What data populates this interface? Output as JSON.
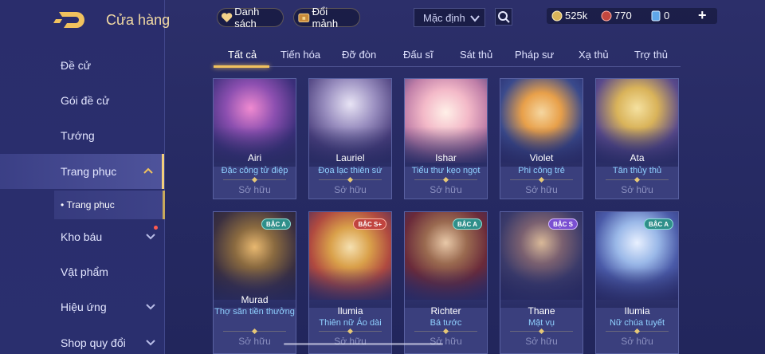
{
  "header": {
    "title": "Cửa hàng"
  },
  "sidebar": {
    "items": [
      {
        "label": "Đề cử"
      },
      {
        "label": "Gói đề cử"
      },
      {
        "label": "Tướng"
      },
      {
        "label": "Trang phục"
      },
      {
        "label": "Kho báu"
      },
      {
        "label": "Vật phẩm"
      },
      {
        "label": "Hiệu ứng"
      },
      {
        "label": "Shop quy đổi"
      }
    ],
    "sub_item": "Trang phục"
  },
  "toolbar": {
    "list_label": "Danh sách",
    "exchange_label": "Đổi mảnh",
    "sort_value": "Mặc định"
  },
  "currency": {
    "coins": "525k",
    "gems": "770",
    "vouchers": "0"
  },
  "tabs": [
    "Tất cả",
    "Tiến hóa",
    "Đỡ đòn",
    "Đấu sĩ",
    "Sát thủ",
    "Pháp sư",
    "Xạ thủ",
    "Trợ thủ"
  ],
  "owned_label": "Sở hữu",
  "cards": [
    {
      "hero": "Airi",
      "skin": "Đặc công tử điệp",
      "badge": ""
    },
    {
      "hero": "Lauriel",
      "skin": "Đọa lạc thiên sứ",
      "badge": ""
    },
    {
      "hero": "Ishar",
      "skin": "Tiểu thư kẹo ngọt",
      "badge": ""
    },
    {
      "hero": "Violet",
      "skin": "Phi công trẻ",
      "badge": ""
    },
    {
      "hero": "Ata",
      "skin": "Tân thủy thủ",
      "badge": ""
    },
    {
      "hero": "Murad",
      "skin": "Thợ săn tiền thưởng",
      "badge": "BẬC A"
    },
    {
      "hero": "Ilumia",
      "skin": "Thiên nữ Áo dài",
      "badge": "BẬC S+"
    },
    {
      "hero": "Richter",
      "skin": "Bá tước",
      "badge": "BẬC A"
    },
    {
      "hero": "Thane",
      "skin": "Mật vụ",
      "badge": "BẬC S"
    },
    {
      "hero": "Ilumia",
      "skin": "Nữ chúa tuyết",
      "badge": "BẬC A"
    }
  ],
  "colors": {
    "accent_gold": "#f1c25e",
    "skin_blue": "#8fd0ff",
    "badge_a": "#2f8f8a",
    "badge_s": "#7a4fd1",
    "badge_splus": "#c0443f"
  }
}
